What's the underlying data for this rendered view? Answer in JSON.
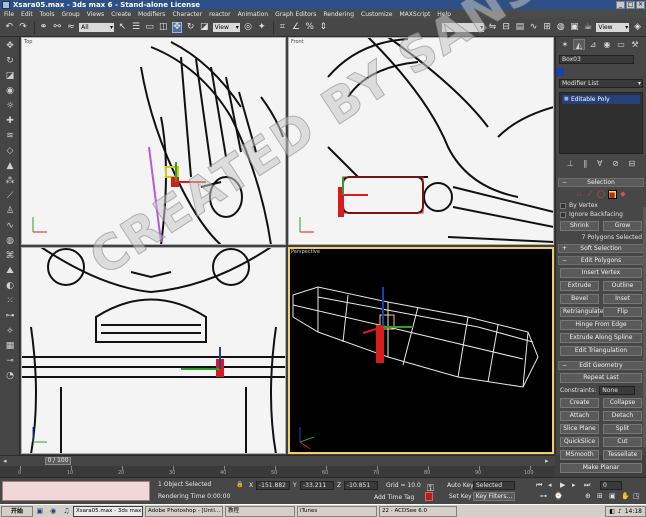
{
  "window": {
    "title": "Xsara05.max - 3ds max 6 - Stand-alone License",
    "min": "_",
    "max": "□",
    "close": "×"
  },
  "menu": [
    "File",
    "Edit",
    "Tools",
    "Group",
    "Views",
    "Create",
    "Modifiers",
    "Character",
    "reactor",
    "Animation",
    "Graph Editors",
    "Rendering",
    "Customize",
    "MAXScript",
    "Help"
  ],
  "toolbar": {
    "selection_filter": "All",
    "ref_coord": "View",
    "ref_coord2": "View",
    "named_sel": ""
  },
  "viewports": {
    "top": "Top",
    "front": "Front",
    "left": "",
    "perspective": "Perspective"
  },
  "command_panel": {
    "object_name": "Box03",
    "object_color": "#1a3fb0",
    "modifier_list": "Modifier List",
    "stack_item": "Editable Poly",
    "selection_title": "Selection",
    "by_vertex": "By Vertex",
    "ignore_backfacing": "Ignore Backfacing",
    "shrink": "Shrink",
    "grow": "Grow",
    "selected_status": "7 Polygons Selected",
    "soft_selection": "Soft Selection",
    "edit_polygons": "Edit Polygons",
    "insert_vertex": "Insert Vertex",
    "extrude": "Extrude",
    "outline": "Outline",
    "bevel": "Bevel",
    "inset": "Inset",
    "retriangulate": "Retriangulate",
    "flip": "Flip",
    "hinge_from_edge": "Hinge From Edge",
    "extrude_along_spline": "Extrude Along Spline",
    "edit_triangulation": "Edit Triangulation",
    "edit_geometry": "Edit Geometry",
    "repeat_last": "Repeat Last",
    "constraints_label": "Constraints:",
    "constraints_value": "None",
    "create": "Create",
    "collapse": "Collapse",
    "attach": "Attach",
    "detach": "Detach",
    "slice_plane": "Slice Plane",
    "split": "Split",
    "quickslice": "QuickSlice",
    "cut": "Cut",
    "msmooth": "MSmooth",
    "tessellate": "Tessellate",
    "make_planar": "Make Planar"
  },
  "timeline": {
    "frame": "0 / 100",
    "ticks": [
      "0",
      "10",
      "20",
      "30",
      "40",
      "50",
      "60",
      "70",
      "80",
      "90",
      "100"
    ]
  },
  "status": {
    "selected": "1 Object Selected",
    "render_time": "Rendering Time  0:00:00",
    "x_label": "X",
    "x": "-151.882",
    "y_label": "Y",
    "y": "-33.211",
    "z_label": "Z",
    "z": "-10.851",
    "grid": "Grid = 10.0",
    "add_time_tag": "Add Time Tag",
    "auto_key": "Auto Key",
    "set_key": "Set Key",
    "selected_dd": "Selected",
    "key_filters": "Key Filters...",
    "frame_field": "0"
  },
  "taskbar": {
    "start": "开始",
    "items": [
      "Xsara05.max - 3ds max ...",
      "Adobe Photoshop - [Unti...",
      "教程",
      "iTunes",
      "22 - ACDSee 6.0"
    ],
    "clock": "14:18"
  },
  "watermark": "CREATED BY SANSHI"
}
